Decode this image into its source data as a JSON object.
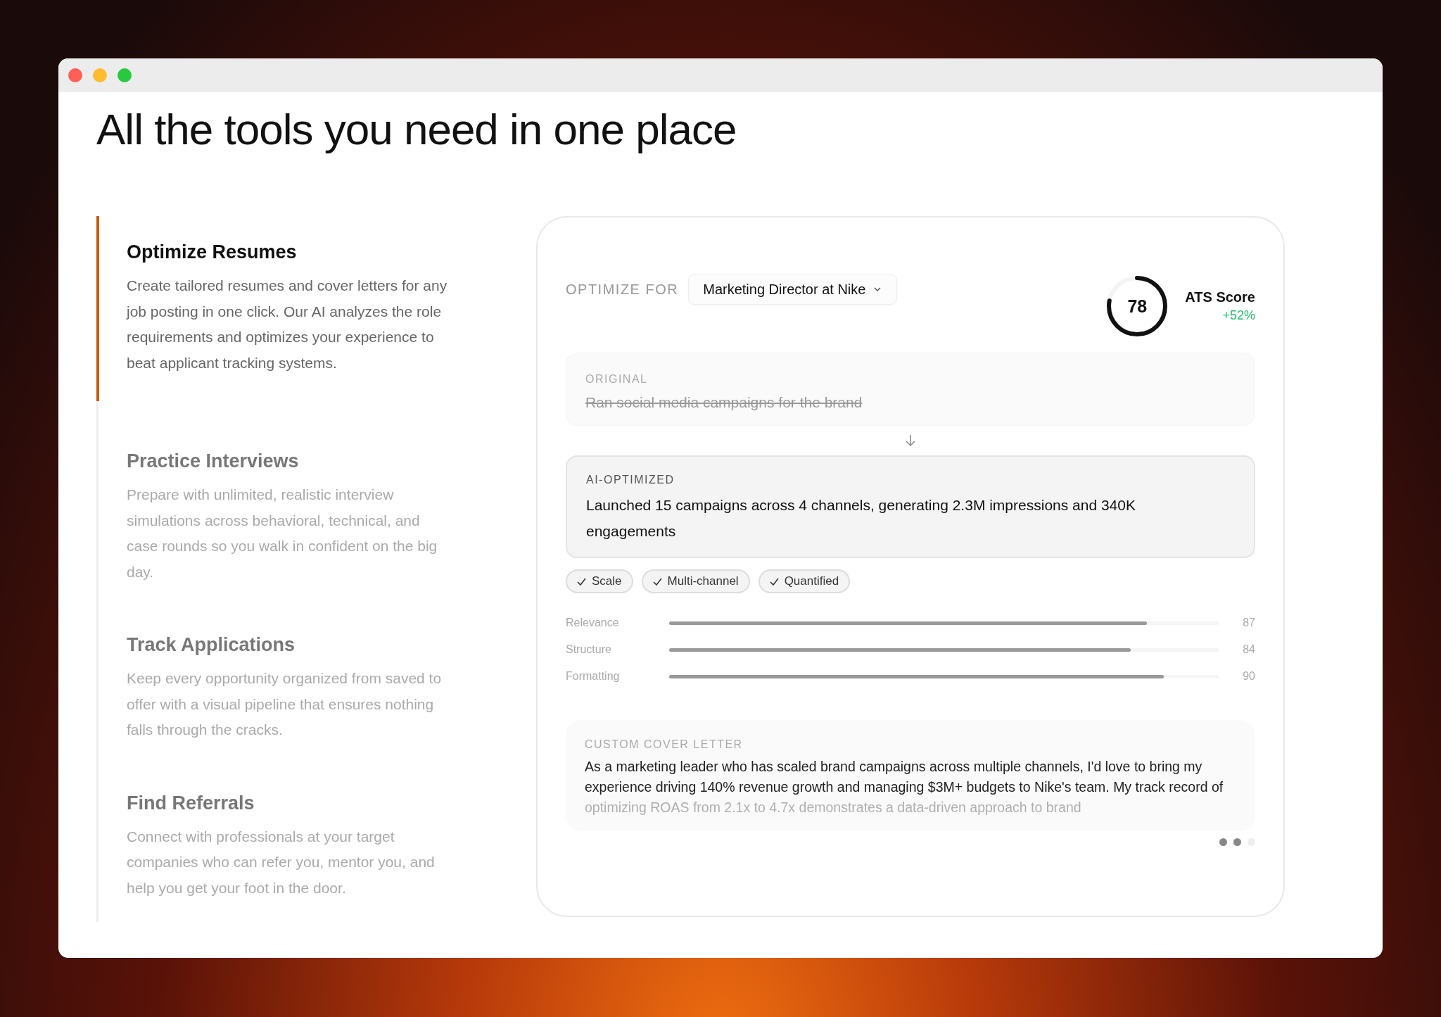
{
  "heading": "All the tools you need in one place",
  "features": [
    {
      "title": "Optimize Resumes",
      "description": "Create tailored resumes and cover letters for any job posting in one click. Our AI analyzes the role requirements and optimizes your experience to beat applicant tracking systems.",
      "selected": true
    },
    {
      "title": "Practice Interviews",
      "description": "Prepare with unlimited, realistic interview simulations across behavioral, technical, and case rounds so you walk in confident on the big day.",
      "selected": false
    },
    {
      "title": "Track Applications",
      "description": "Keep every opportunity organized from saved to offer with a visual pipeline that ensures nothing falls through the cracks.",
      "selected": false
    },
    {
      "title": "Find Referrals",
      "description": "Connect with professionals at your target companies who can refer you, mentor you, and help you get your foot in the door.",
      "selected": false
    }
  ],
  "demo": {
    "optimize_label": "OPTIMIZE FOR",
    "target_job": "Marketing Director at Nike",
    "ats": {
      "score": "78",
      "level": 0.78,
      "label": "ATS Score",
      "change": "+52%"
    },
    "original": {
      "label": "ORIGINAL",
      "text": "Ran social media campaigns for the brand"
    },
    "optimized": {
      "label": "AI-OPTIMIZED",
      "text": "Launched 15 campaigns across 4 channels, generating 2.3M impressions and 340K engagements"
    },
    "tags": [
      "Scale",
      "Multi-channel",
      "Quantified"
    ],
    "metrics": [
      {
        "name": "Relevance",
        "level": 0.87,
        "value": "87"
      },
      {
        "name": "Structure",
        "level": 0.84,
        "value": "84"
      },
      {
        "name": "Formatting",
        "level": 0.9,
        "value": "90"
      }
    ],
    "cover_letter": {
      "label": "CUSTOM COVER LETTER",
      "text": "As a marketing leader who has scaled brand campaigns across multiple channels, I'd love to bring my experience driving 140% revenue growth and managing $3M+ budgets to Nike's team. My track record of optimizing ROAS from 2.1x to 4.7x demonstrates a data-driven approach to brand"
    },
    "dots": [
      {
        "selected": true
      },
      {
        "selected": true
      },
      {
        "selected": false
      }
    ]
  }
}
